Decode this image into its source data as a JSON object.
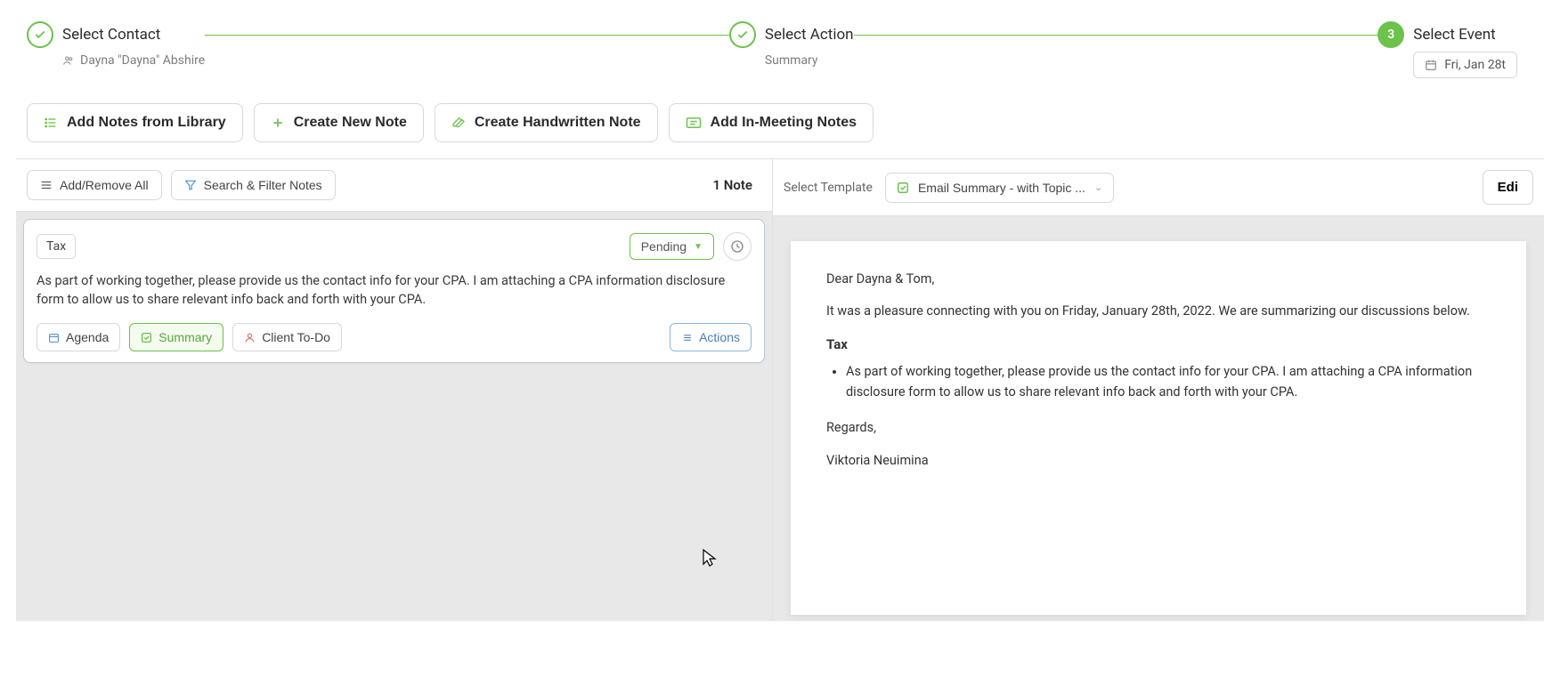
{
  "stepper": {
    "step1": {
      "title": "Select Contact",
      "sub": "Dayna \"Dayna\" Abshire"
    },
    "step2": {
      "title": "Select Action",
      "sub": "Summary"
    },
    "step3": {
      "num": "3",
      "title": "Select Event",
      "date": "Fri, Jan 28t"
    }
  },
  "buttons": {
    "library": "Add Notes from Library",
    "newnote": "Create New Note",
    "handwritten": "Create Handwritten Note",
    "inmeeting": "Add In-Meeting Notes"
  },
  "filters": {
    "addremove": "Add/Remove All",
    "search": "Search & Filter Notes",
    "count": "1 Note",
    "selectTemplateLabel": "Select Template",
    "templateValue": "Email Summary - with Topic ...",
    "edit": "Edi"
  },
  "note": {
    "tag": "Tax",
    "status": "Pending",
    "body": "As part of working together, please provide us the contact info for your CPA. I am attaching a CPA information disclosure form to allow us to share relevant info back and forth with your CPA.",
    "chips": {
      "agenda": "Agenda",
      "summary": "Summary",
      "clienttodo": "Client To-Do",
      "actions": "Actions"
    }
  },
  "preview": {
    "greeting": "Dear Dayna & Tom,",
    "intro": "It was a pleasure connecting with you on Friday, January 28th, 2022. We are summarizing our discussions below.",
    "section": "Tax",
    "bullet": "As part of working together, please provide us the contact info for your CPA. I am attaching a CPA information disclosure form to allow us to share relevant info back and forth with your CPA.",
    "regards": "Regards,",
    "signature": "Viktoria Neuimina"
  }
}
